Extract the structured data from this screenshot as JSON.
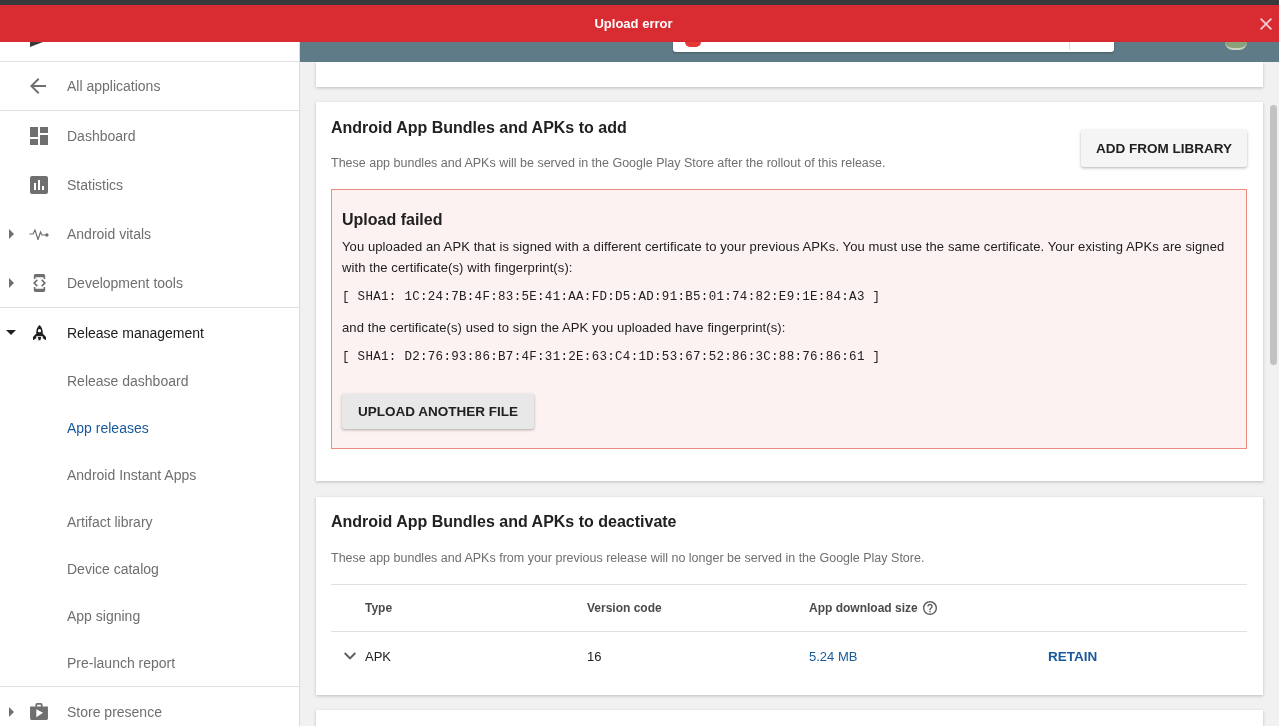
{
  "banner": {
    "title": "Upload error"
  },
  "sidebar": {
    "back_link": "All applications",
    "groups": [
      {
        "items": [
          {
            "label": "Dashboard",
            "selected": false
          },
          {
            "label": "Statistics",
            "selected": false
          },
          {
            "label": "Android vitals",
            "selected": false,
            "expanded": false
          },
          {
            "label": "Development tools",
            "selected": false,
            "expanded": false
          }
        ]
      },
      {
        "items": [
          {
            "label": "Release management",
            "selected": false,
            "expanded": true,
            "children": [
              {
                "label": "Release dashboard",
                "selected": false
              },
              {
                "label": "App releases",
                "selected": true
              },
              {
                "label": "Android Instant Apps",
                "selected": false
              },
              {
                "label": "Artifact library",
                "selected": false
              },
              {
                "label": "Device catalog",
                "selected": false
              },
              {
                "label": "App signing",
                "selected": false
              },
              {
                "label": "Pre-launch report",
                "selected": false
              }
            ]
          }
        ]
      },
      {
        "items": [
          {
            "label": "Store presence",
            "selected": false,
            "expanded": false
          }
        ]
      }
    ]
  },
  "add_section": {
    "title": "Android App Bundles and APKs to add",
    "description": "These app bundles and APKs will be served in the Google Play Store after the rollout of this release.",
    "button": "ADD FROM LIBRARY",
    "error": {
      "title": "Upload failed",
      "message": "You uploaded an APK that is signed with a different certificate to your previous APKs. You must use the same certificate. Your existing APKs are signed with the certificate(s) with fingerprint(s):",
      "existing_fingerprint": "[ SHA1: 1C:24:7B:4F:83:5E:41:AA:FD:D5:AD:91:B5:01:74:82:E9:1E:84:A3 ]",
      "note": "and the certificate(s) used to sign the APK you uploaded have fingerprint(s):",
      "uploaded_fingerprint": "[ SHA1: D2:76:93:86:B7:4F:31:2E:63:C4:1D:53:67:52:86:3C:88:76:86:61 ]",
      "button": "UPLOAD ANOTHER FILE"
    }
  },
  "deactivate_section": {
    "title": "Android App Bundles and APKs to deactivate",
    "description": "These app bundles and APKs from your previous release will no longer be served in the Google Play Store.",
    "table": {
      "columns": [
        {
          "label": "Type",
          "help": false
        },
        {
          "label": "Version code",
          "help": false
        },
        {
          "label": "App download size",
          "help": true
        }
      ],
      "rows": [
        {
          "expanded": false,
          "type": "APK",
          "version_code": "16",
          "download_size": "5.24 MB",
          "action": "RETAIN"
        }
      ]
    }
  }
}
